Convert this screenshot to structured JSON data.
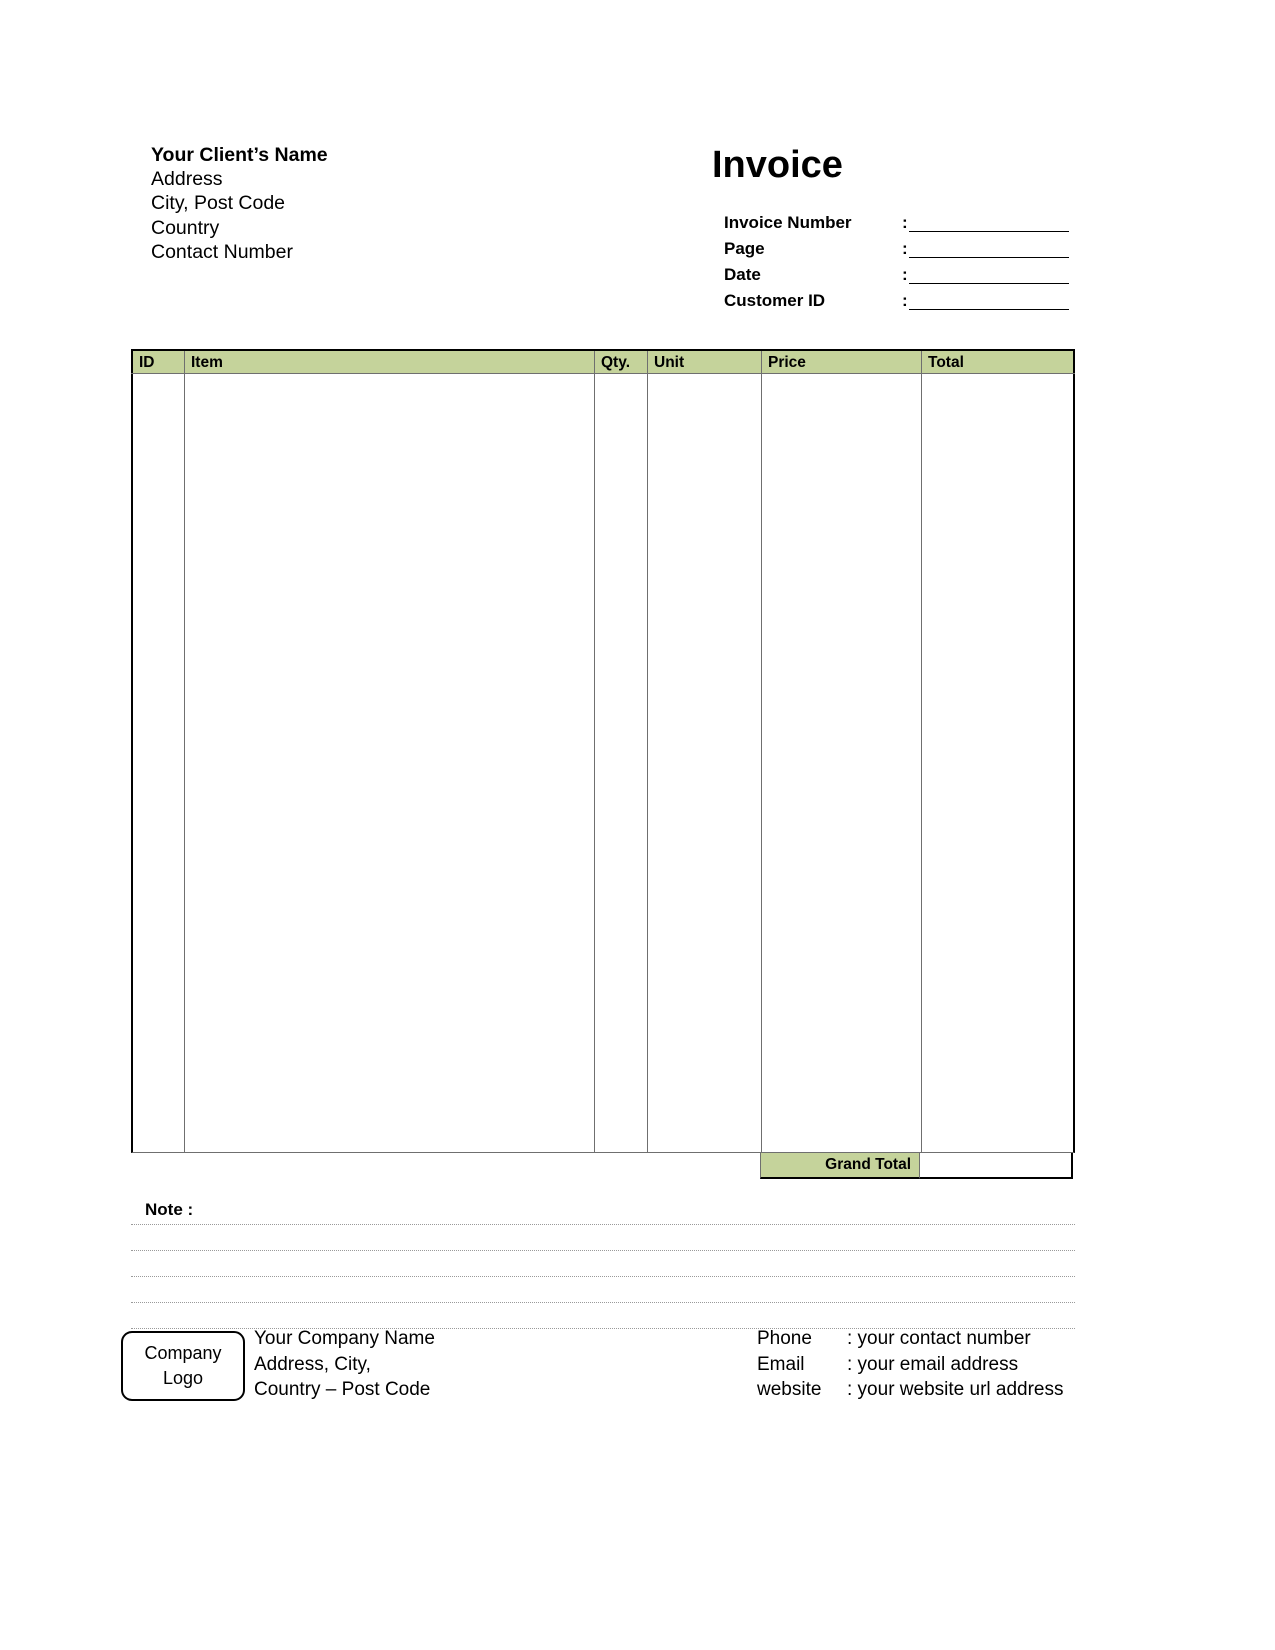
{
  "client": {
    "name": "Your Client’s Name",
    "lines": [
      "Address",
      "City, Post Code",
      "Country",
      "Contact Number"
    ]
  },
  "header": {
    "title": "Invoice",
    "colon": ":",
    "fields": [
      {
        "label": "Invoice Number",
        "value": ""
      },
      {
        "label": "Page",
        "value": ""
      },
      {
        "label": "Date",
        "value": ""
      },
      {
        "label": "Customer ID",
        "value": ""
      }
    ]
  },
  "table": {
    "columns": [
      "ID",
      "Item",
      "Qty.",
      "Unit",
      "Price",
      "Total"
    ],
    "rows": [],
    "grand_total_label": "Grand Total",
    "grand_total_value": "",
    "header_background": "#c5d39b",
    "border_color": "#6f6f6f"
  },
  "note": {
    "label": "Note :",
    "lines": [
      "",
      "",
      "",
      "",
      ""
    ]
  },
  "footer": {
    "logo": {
      "line1": "Company",
      "line2": "Logo"
    },
    "company": [
      "Your Company Name",
      "Address, City,",
      "Country – Post Code"
    ],
    "contacts": [
      {
        "key": "Phone",
        "value": ": your contact number"
      },
      {
        "key": "Email",
        "value": ": your email address"
      },
      {
        "key": "website",
        "value": ": your website url address"
      }
    ]
  }
}
